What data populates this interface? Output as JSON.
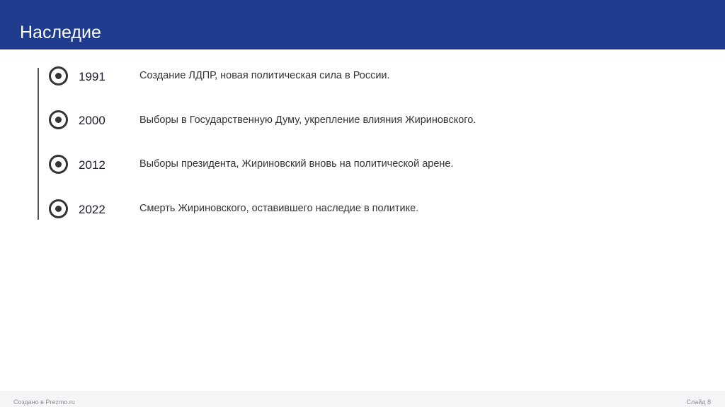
{
  "slide": {
    "title": "Наследие",
    "accent_color": "#1f3c8f"
  },
  "timeline": {
    "icon": "target-circle-icon",
    "events": [
      {
        "year": "1991",
        "text": "Создание ЛДПР, новая политическая сила в России."
      },
      {
        "year": "2000",
        "text": "Выборы в Государственную Думу, укрепление влияния Жириновского."
      },
      {
        "year": "2012",
        "text": "Выборы президента, Жириновский вновь на политической арене."
      },
      {
        "year": "2022",
        "text": "Смерть Жириновского, оставившего наследие в политике."
      }
    ]
  },
  "footer": {
    "left": "Создано в Prezmo.ru",
    "right": "Слайд 8"
  }
}
